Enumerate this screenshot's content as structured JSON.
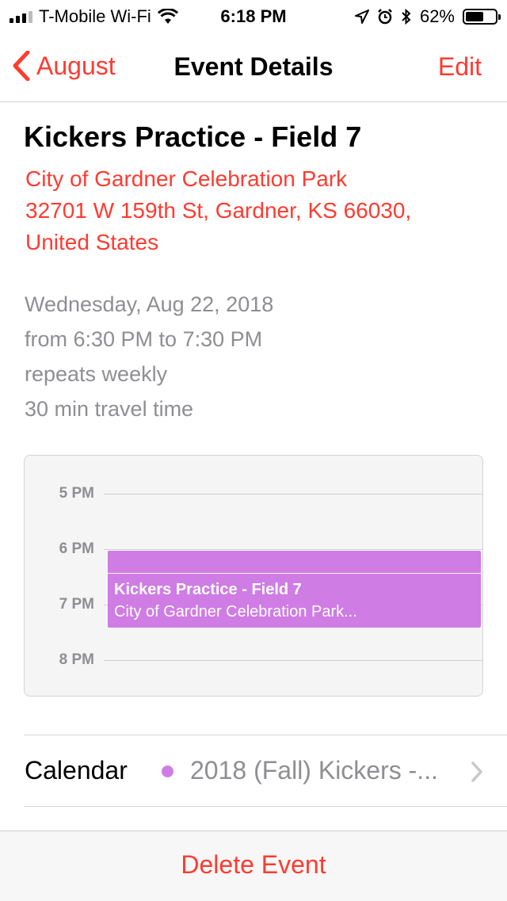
{
  "status_bar": {
    "carrier": "T-Mobile Wi-Fi",
    "time": "6:18 PM",
    "battery": "62%",
    "battery_level": 0.62,
    "icons": [
      "signal-icon",
      "wifi-icon",
      "location-arrow-icon",
      "alarm-icon",
      "bluetooth-icon",
      "battery-icon"
    ]
  },
  "nav": {
    "back_label": "August",
    "title": "Event Details",
    "edit_label": "Edit"
  },
  "event": {
    "title": "Kickers Practice - Field 7",
    "location_lines": [
      "City of Gardner Celebration Park",
      "32701 W 159th St, Gardner, KS  66030,",
      "United States"
    ],
    "date": "Wednesday, Aug 22, 2018",
    "time_range": "from 6:30 PM to 7:30 PM",
    "repeat": "repeats weekly",
    "travel": "30 min travel time"
  },
  "mini_calendar": {
    "hours": [
      "5 PM",
      "6 PM",
      "7 PM",
      "8 PM"
    ],
    "block_title": "Kickers Practice - Field 7",
    "block_subtitle": "City of Gardner Celebration Park..."
  },
  "calendar_row": {
    "label": "Calendar",
    "value": "2018 (Fall) Kickers -...",
    "dot_color": "#cf7ce4"
  },
  "footer": {
    "delete_label": "Delete Event"
  },
  "colors": {
    "accent": "#ff3b30",
    "event": "#cf7ce4",
    "secondary_text": "#8e8e93"
  }
}
